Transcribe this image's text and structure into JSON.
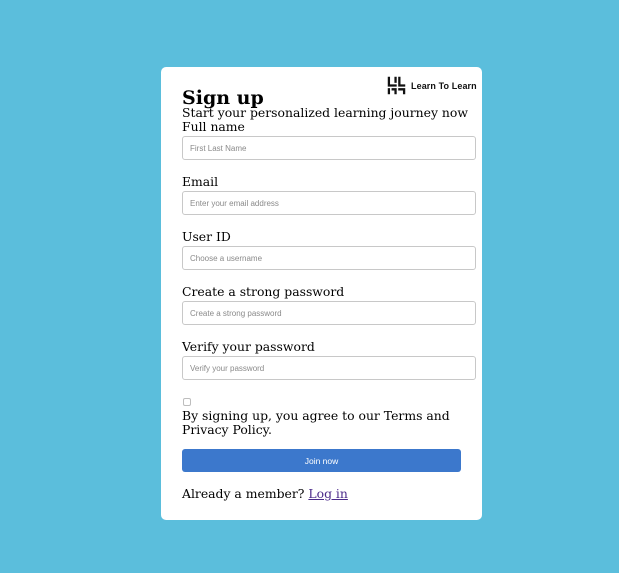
{
  "brand": {
    "logo_icon": "maze-icon",
    "logo_text": "Learn To Learn"
  },
  "header": {
    "title": "Sign up",
    "subtitle": "Start your personalized learning journey now"
  },
  "form": {
    "full_name": {
      "label": "Full name",
      "placeholder": "First Last Name",
      "value": ""
    },
    "email": {
      "label": "Email",
      "placeholder": "Enter your email address",
      "value": ""
    },
    "user_id": {
      "label": "User ID",
      "placeholder": "Choose a username",
      "value": ""
    },
    "password": {
      "label": "Create a strong password",
      "placeholder": "Create a strong password",
      "value": ""
    },
    "verify_password": {
      "label": "Verify your password",
      "placeholder": "Verify your password",
      "value": ""
    },
    "terms": {
      "checked": false,
      "text": "By signing up, you agree to our Terms and Privacy Policy."
    },
    "submit_label": "Join now"
  },
  "footer": {
    "member_text": "Already a member?",
    "login_label": "Log in"
  },
  "colors": {
    "background": "#5bbedc",
    "card": "#ffffff",
    "button": "#3c78cc",
    "link": "#4b2a8a"
  }
}
